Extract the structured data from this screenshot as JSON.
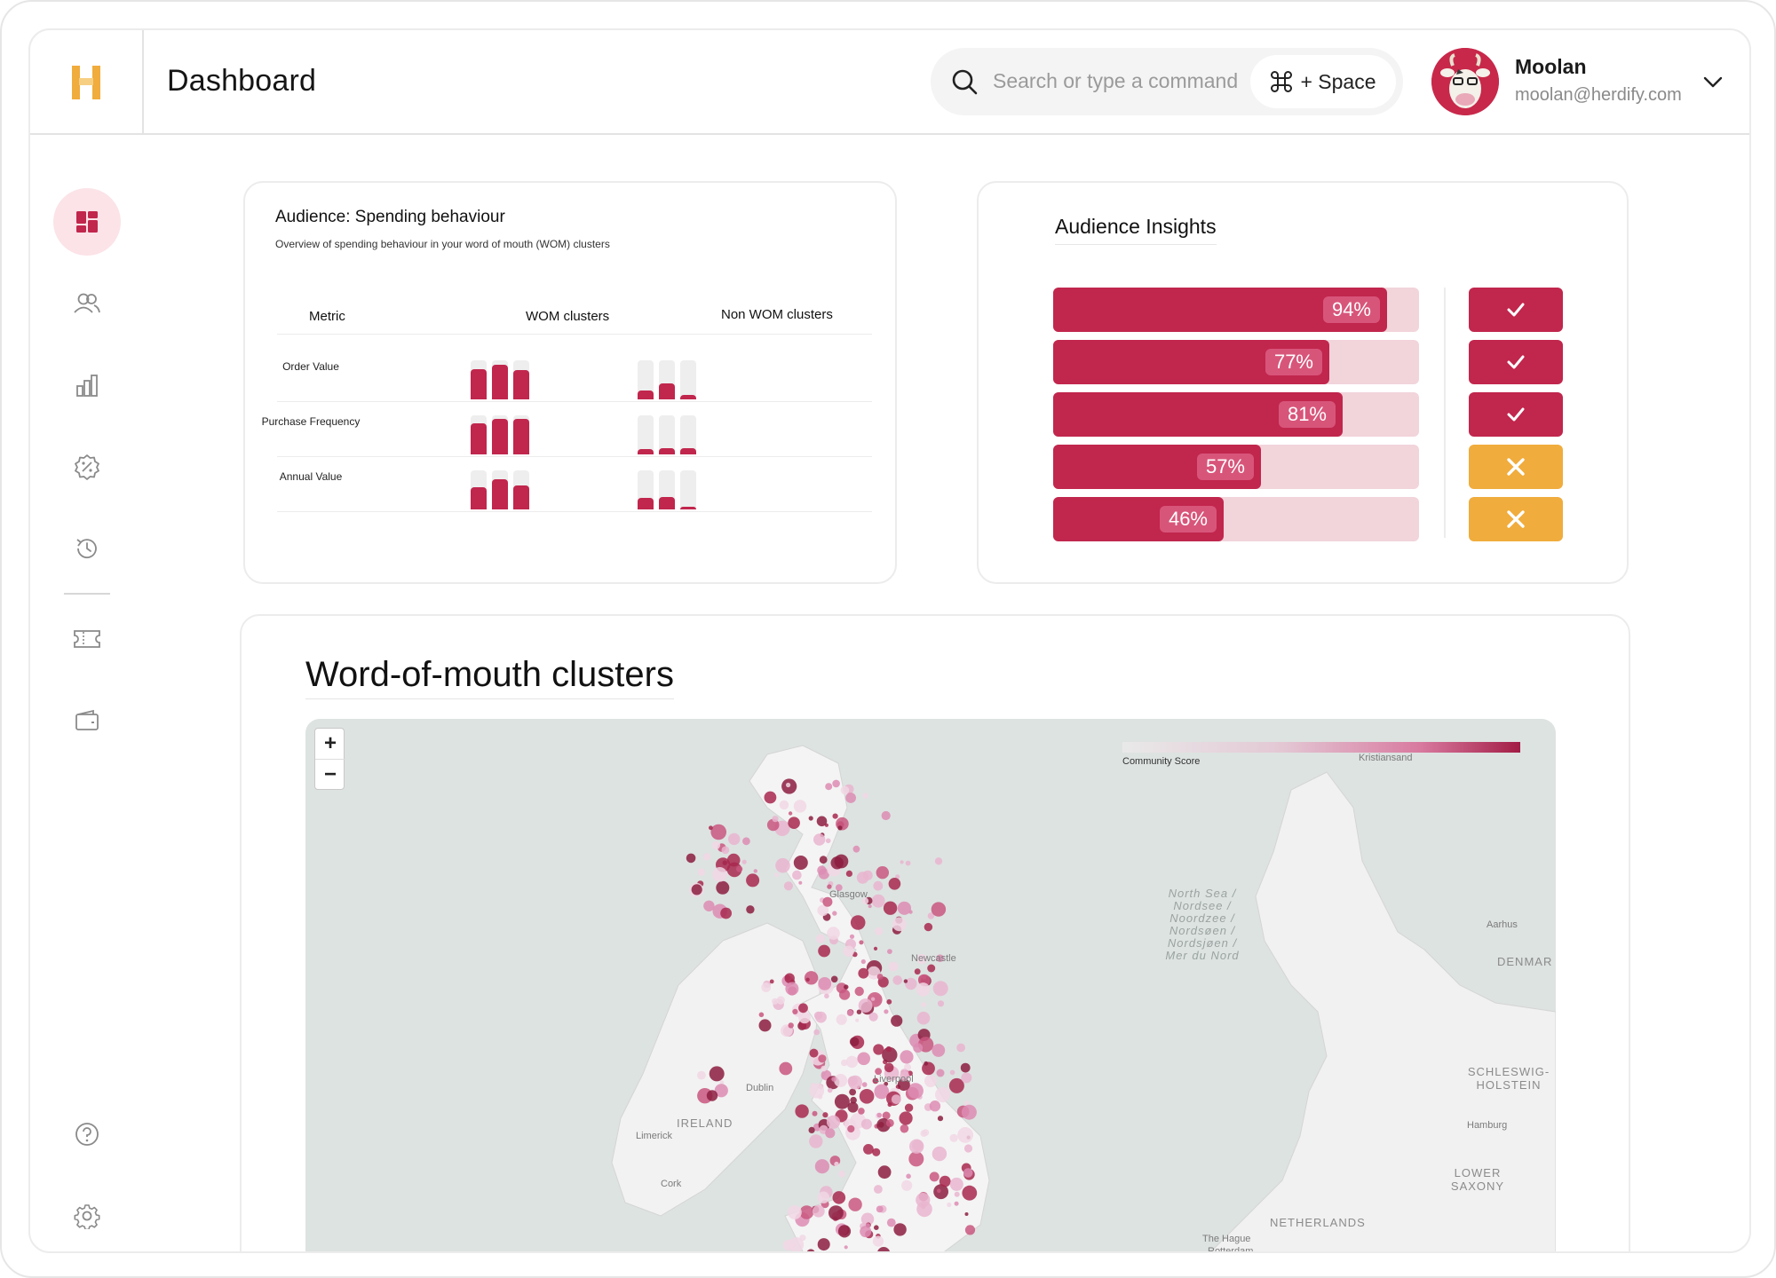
{
  "header": {
    "title": "Dashboard",
    "search_placeholder": "Search or type a command",
    "shortcut_label": "+ Space",
    "user": {
      "name": "Moolan",
      "email": "moolan@herdify.com"
    }
  },
  "sidebar": {
    "items": [
      {
        "name": "dashboard",
        "icon": "dashboard-icon",
        "active": true
      },
      {
        "name": "audience",
        "icon": "users-icon",
        "active": false
      },
      {
        "name": "analytics",
        "icon": "bar-chart-icon",
        "active": false
      },
      {
        "name": "offers",
        "icon": "discount-badge-icon",
        "active": false
      },
      {
        "name": "history",
        "icon": "history-icon",
        "active": false
      },
      {
        "name": "tickets",
        "icon": "ticket-icon",
        "active": false
      },
      {
        "name": "wallet",
        "icon": "wallet-icon",
        "active": false
      },
      {
        "name": "help",
        "icon": "help-circle-icon",
        "active": false
      },
      {
        "name": "settings",
        "icon": "gear-icon",
        "active": false
      }
    ]
  },
  "spending": {
    "title": "Audience: Spending behaviour",
    "subtitle": "Overview of spending behaviour in your word of mouth (WOM) clusters",
    "columns": {
      "metric": "Metric",
      "wom": "WOM clusters",
      "non_wom": "Non WOM clusters"
    },
    "rows": [
      {
        "label": "Order Value",
        "wom": [
          0.78,
          0.88,
          0.74
        ],
        "non_wom": [
          0.22,
          0.42,
          0.12
        ]
      },
      {
        "label": "Purchase Frequency",
        "wom": [
          0.8,
          0.9,
          0.9
        ],
        "non_wom": [
          0.14,
          0.16,
          0.16
        ]
      },
      {
        "label": "Annual Value",
        "wom": [
          0.56,
          0.77,
          0.62
        ],
        "non_wom": [
          0.3,
          0.32,
          0.06
        ]
      }
    ]
  },
  "insights": {
    "title": "Audience Insights",
    "bars": [
      {
        "value": 94,
        "label": "94%",
        "status": "pass"
      },
      {
        "value": 77,
        "label": "77%",
        "status": "pass"
      },
      {
        "value": 81,
        "label": "81%",
        "status": "pass"
      },
      {
        "value": 57,
        "label": "57%",
        "status": "fail"
      },
      {
        "value": 46,
        "label": "46%",
        "status": "fail"
      }
    ],
    "colors": {
      "fill": "#c1264d",
      "track": "#f2d4db",
      "pass": "#c1264d",
      "fail": "#f0ac3c"
    }
  },
  "map": {
    "title": "Word-of-mouth clusters",
    "legend_label": "Community Score",
    "zoom_in": "+",
    "zoom_out": "−",
    "labels": {
      "ireland": "IRELAND",
      "dublin": "Dublin",
      "limerick": "Limerick",
      "cork": "Cork",
      "netherlands": "NETHERLANDS",
      "schleswig": "SCHLESWIG-HOLSTEIN",
      "hamburg": "Hamburg",
      "lower_saxony": "LOWER SAXONY",
      "denmark": "DENMAR",
      "aarhus": "Aarhus",
      "kristiansand": "Kristiansand",
      "the_hague": "The Hague",
      "rotterdam": "Rotterdam",
      "glasgow": "Glasgow",
      "newcastle": "Newcastle",
      "liverpool": "Liverpool",
      "north_sea": "North Sea / Nordsee / Noordzee / Nordsøen / Nordsjøen / Mer du Nord"
    }
  }
}
